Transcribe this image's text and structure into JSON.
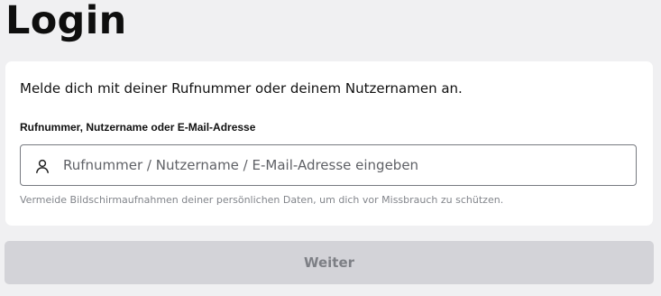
{
  "page": {
    "title": "Login"
  },
  "form": {
    "intro": "Melde dich mit deiner Rufnummer oder deinem Nutzernamen an.",
    "field_label": "Rufnummer, Nutzername oder E-Mail-Adresse",
    "input_value": "",
    "input_placeholder": "Rufnummer / Nutzername / E-Mail-Adresse eingeben",
    "input_icon": "user-icon",
    "hint": "Vermeide Bildschirmaufnahmen deiner persönlichen Daten, um dich vor Missbrauch zu schützen."
  },
  "actions": {
    "next_label": "Weiter",
    "next_disabled": true
  },
  "colors": {
    "background": "#f0f0f2",
    "card": "#ffffff",
    "button_disabled_bg": "#d3d3d8",
    "button_disabled_text": "#7d7f85",
    "hint_text": "#82858b",
    "input_border": "#777a80"
  }
}
